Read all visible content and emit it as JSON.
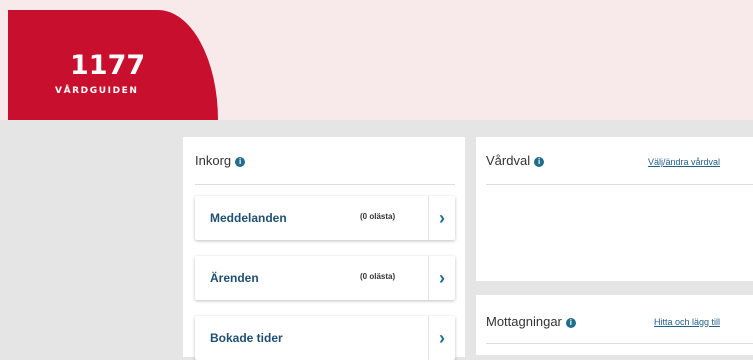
{
  "logo": {
    "number": "1177",
    "subtitle": "VÅRDGUIDEN"
  },
  "inkorg": {
    "title": "Inkorg",
    "items": [
      {
        "label": "Meddelanden",
        "badge": "(0 olästa)"
      },
      {
        "label": "Ärenden",
        "badge": "(0 olästa)"
      },
      {
        "label": "Bokade tider",
        "badge": ""
      }
    ]
  },
  "vardval": {
    "title": "Vårdval",
    "link": "Välj/ändra vårdval"
  },
  "mottagningar": {
    "title": "Mottagningar",
    "link": "Hitta och lägg till"
  },
  "icons": {
    "info": "info-icon",
    "chevron": "chevron-right-icon"
  },
  "colors": {
    "brand": "#c8102e",
    "header_bg": "#f8e9ea",
    "accent": "#1f6e8c"
  }
}
